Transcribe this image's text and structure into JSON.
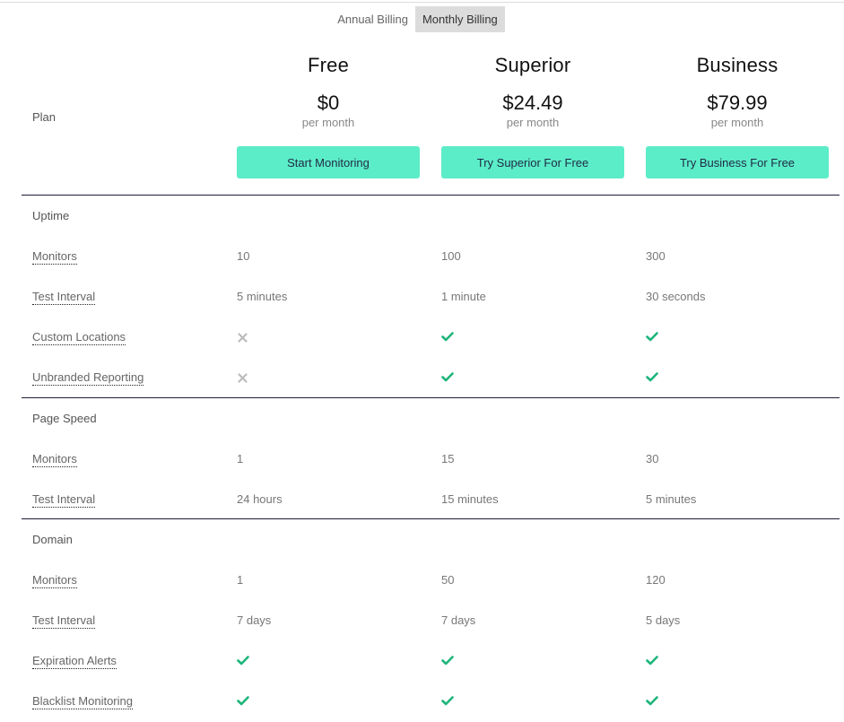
{
  "billing": {
    "options": [
      {
        "label": "Annual Billing",
        "active": false
      },
      {
        "label": "Monthly Billing",
        "active": true
      }
    ]
  },
  "plan_row_label": "Plan",
  "plans": [
    {
      "name": "Free",
      "price": "$0",
      "period": "per month",
      "cta": "Start Monitoring"
    },
    {
      "name": "Superior",
      "price": "$24.49",
      "period": "per month",
      "cta": "Try Superior For Free"
    },
    {
      "name": "Business",
      "price": "$79.99",
      "period": "per month",
      "cta": "Try Business For Free"
    }
  ],
  "colors": {
    "accent": "#5bedc8",
    "check": "#1db57a",
    "cross": "#bbbbbb",
    "rule": "#1e1b33"
  },
  "icons": {
    "yes": "check-icon",
    "no": "cross-icon"
  },
  "sections": [
    {
      "title": "Uptime",
      "rows": [
        {
          "label": "Monitors",
          "values": [
            "10",
            "100",
            "300"
          ]
        },
        {
          "label": "Test Interval",
          "values": [
            "5 minutes",
            "1 minute",
            "30 seconds"
          ]
        },
        {
          "label": "Custom Locations",
          "values": [
            "no",
            "yes",
            "yes"
          ]
        },
        {
          "label": "Unbranded Reporting",
          "values": [
            "no",
            "yes",
            "yes"
          ]
        }
      ]
    },
    {
      "title": "Page Speed",
      "rows": [
        {
          "label": "Monitors",
          "values": [
            "1",
            "15",
            "30"
          ]
        },
        {
          "label": "Test Interval",
          "values": [
            "24 hours",
            "15 minutes",
            "5 minutes"
          ]
        }
      ]
    },
    {
      "title": "Domain",
      "rows": [
        {
          "label": "Monitors",
          "values": [
            "1",
            "50",
            "120"
          ]
        },
        {
          "label": "Test Interval",
          "values": [
            "7 days",
            "7 days",
            "5 days"
          ]
        },
        {
          "label": "Expiration Alerts",
          "values": [
            "yes",
            "yes",
            "yes"
          ]
        },
        {
          "label": "Blacklist Monitoring",
          "values": [
            "yes",
            "yes",
            "yes"
          ]
        }
      ]
    }
  ]
}
